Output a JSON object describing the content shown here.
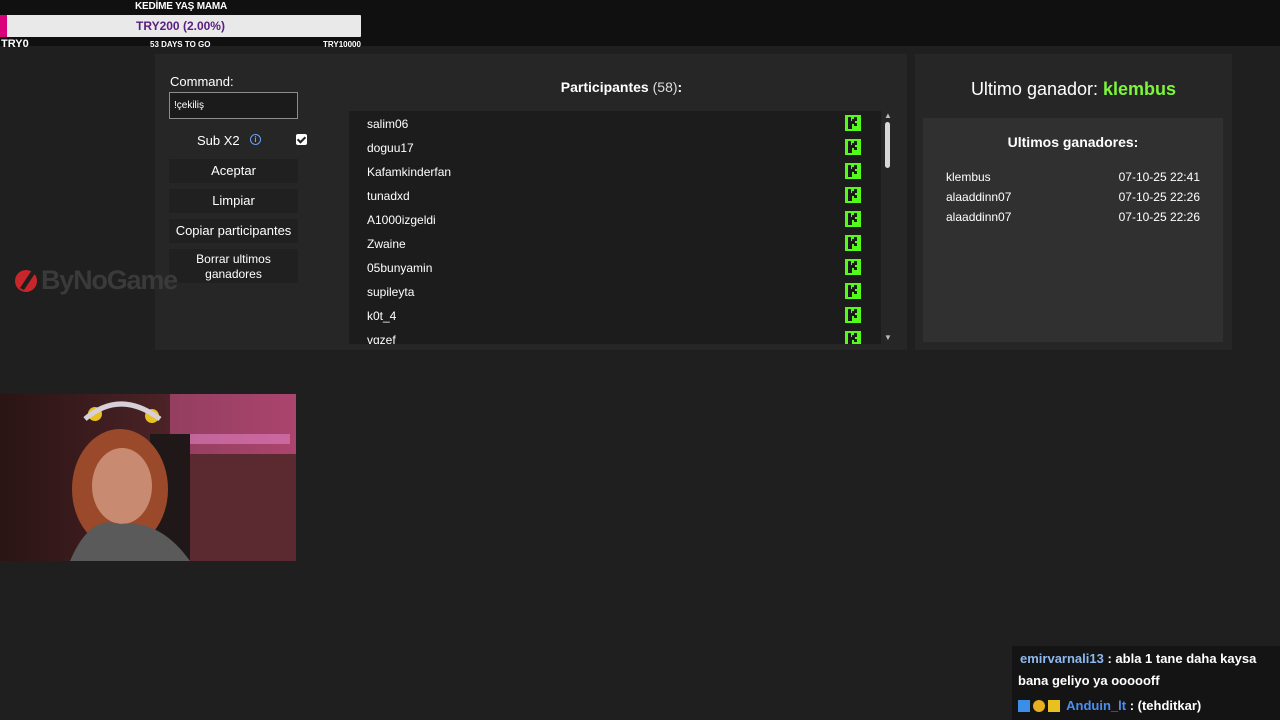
{
  "goal": {
    "title": "KEDİME YAŞ MAMA",
    "amount_text": "TRY200 (2.00%)",
    "progress_fraction": 0.02,
    "left_label": "TRY0",
    "mid_label": "53 DAYS TO GO",
    "right_label": "TRY10000",
    "fill_color": "#d9007a"
  },
  "controls": {
    "command_label": "Command:",
    "command_value": "!çekiliş",
    "sub_label": "Sub X2",
    "sub_checked": true,
    "aceptar": "Aceptar",
    "limpiar": "Limpiar",
    "copiar": "Copiar participantes",
    "borrar_line1": "Borrar ultimos",
    "borrar_line2": "ganadores"
  },
  "participants": {
    "title": "Participantes",
    "count_text": "(58)",
    "suffix": ":",
    "items": [
      "salim06",
      "doguu17",
      "Kafamkinderfan",
      "tunadxd",
      "A1000izgeldi",
      "Zwaine",
      "05bunyamin",
      "supileyta",
      "k0t_4",
      "vgzef"
    ],
    "platform_icon": "kick-icon",
    "accent_color": "#53fc18"
  },
  "winner": {
    "label": "Ultimo ganador:",
    "name": "klembus",
    "name_color": "#7cf53a"
  },
  "recent_winners": {
    "title": "Ultimos ganadores:",
    "rows": [
      {
        "name": "klembus",
        "date": "07-10-25 22:41"
      },
      {
        "name": "alaaddinn07",
        "date": "07-10-25 22:26"
      },
      {
        "name": "alaaddinn07",
        "date": "07-10-25 22:26"
      }
    ]
  },
  "logo": {
    "text": "ByNoGame"
  },
  "chat": {
    "messages": [
      {
        "user": "emirvarnali13",
        "text": ": abla 1 tane daha kaysa",
        "text2": "bana geliyo ya oooooff"
      },
      {
        "user": "Anduin_lt",
        "text": ": (tehditkar)"
      }
    ]
  }
}
